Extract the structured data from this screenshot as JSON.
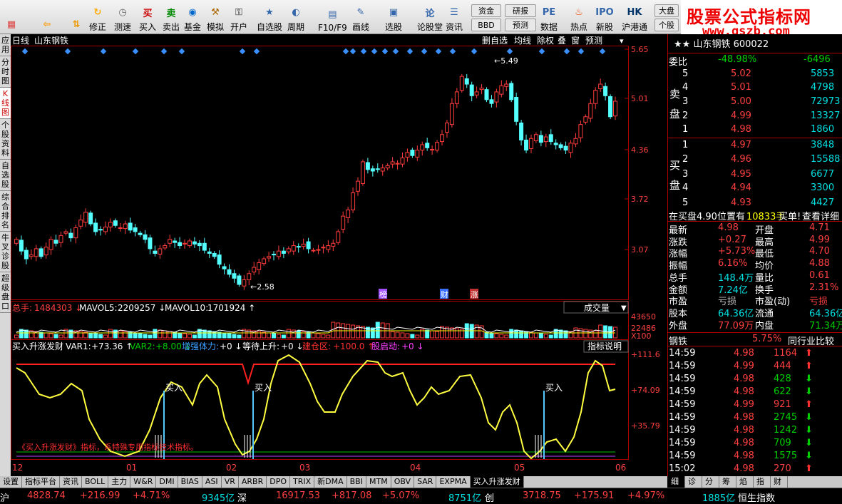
{
  "toolbar": {
    "buttons": [
      {
        "label": "",
        "icon": "grid-icon"
      },
      {
        "label": "",
        "icon": "back-arrow-icon"
      },
      {
        "label": "",
        "icon": "up-down-icon"
      },
      {
        "label": "修正",
        "icon": "restore-icon"
      },
      {
        "label": "测速",
        "icon": "clock-icon"
      },
      {
        "label": "买入",
        "icon": "buy-icon"
      },
      {
        "label": "卖出",
        "icon": "sell-icon"
      },
      {
        "label": "基金",
        "icon": "fund-icon"
      },
      {
        "label": "模拟",
        "icon": "hammer-icon"
      },
      {
        "label": "开户",
        "icon": "lock-icon"
      },
      {
        "label": "自选股",
        "icon": "star-icon"
      },
      {
        "label": "周期",
        "icon": "cycle-icon"
      },
      {
        "label": "F10/F9",
        "icon": "f10-icon"
      },
      {
        "label": "画线",
        "icon": "pen-icon"
      },
      {
        "label": "选股",
        "icon": "select-icon"
      },
      {
        "label": "论股堂",
        "icon": "forum-icon"
      },
      {
        "label": "资讯",
        "icon": "news-icon"
      },
      {
        "label": "数据",
        "icon": "pe-icon"
      },
      {
        "label": "热点",
        "icon": "hot-icon"
      },
      {
        "label": "新股",
        "icon": "ipo-icon"
      },
      {
        "label": "沪港通",
        "icon": "hk-icon"
      }
    ],
    "small_buttons": [
      "资金",
      "BBD",
      "研报",
      "预测",
      "大盘",
      "个股"
    ]
  },
  "logo": {
    "title": "股票公式指标网",
    "url": "www.gszb.com"
  },
  "left_tabs": [
    "应用",
    "分时图",
    "K线图",
    "个股资料",
    "自选股",
    "综合排名",
    "牛叉诊股",
    "超级盘口"
  ],
  "chart": {
    "period_label": "日线",
    "stock_name": "山东钢铁",
    "top_tools": [
      "删自选",
      "均线",
      "除权",
      "叠",
      "窗",
      "预测"
    ],
    "price_axis": [
      "5.65",
      "5.01",
      "4.36",
      "3.72",
      "3.07"
    ],
    "high_label": "5.49",
    "low_label": "2.58",
    "event_labels": [
      "榜",
      "财",
      "涨"
    ],
    "volume": {
      "total_label": "总手:",
      "total": "1484303",
      "ma5_label": "MAVOL5:",
      "ma5": "2209257",
      "ma10_label": "MAVOL10:",
      "ma10": "1701924",
      "dropdown": "成交量",
      "axis": [
        "43650",
        "22486",
        "X100"
      ]
    },
    "indicator": {
      "name": "买入升涨发财",
      "var1_label": "VAR1:",
      "var1": "+73.36",
      "var2_label": "VAR2:",
      "var2": "+8.00",
      "power_label": "增强体力:",
      "power": "+0",
      "wait_label": "等待上升:",
      "wait": "+0",
      "warehouse_label": "建仓区:",
      "warehouse": "+100.0",
      "start_label": "股启动:",
      "start": "+0",
      "help_button": "指标说明",
      "axis": [
        "+111.6",
        "+74.09",
        "+35.79"
      ],
      "buy_label": "买入",
      "watermark": "《买入升涨发财》指标，系特殊专用指标技术指标。"
    },
    "time_axis": [
      "12",
      "01",
      "02",
      "03",
      "04",
      "05",
      "06"
    ]
  },
  "right": {
    "header": "山东钢铁 600022",
    "weibi_label": "委比",
    "weibi": "-48.98%",
    "weicha": "-6496",
    "sell_label": "卖盘",
    "sells": [
      [
        "5",
        "5.02",
        "5853"
      ],
      [
        "4",
        "5.01",
        "4798"
      ],
      [
        "3",
        "5.00",
        "72973"
      ],
      [
        "2",
        "4.99",
        "13327"
      ],
      [
        "1",
        "4.98",
        "1860"
      ]
    ],
    "buy_label": "买盘",
    "buys": [
      [
        "1",
        "4.97",
        "3848"
      ],
      [
        "2",
        "4.96",
        "15588"
      ],
      [
        "3",
        "4.95",
        "6677"
      ],
      [
        "4",
        "4.94",
        "3300"
      ],
      [
        "5",
        "4.93",
        "4427"
      ]
    ],
    "info_line": "在买盘4.90位置有",
    "info_vol": "10833手",
    "info_btn1": "买单!",
    "info_btn2": "查看详细",
    "stats": [
      [
        "最新",
        "4.98",
        "开盘",
        "4.71"
      ],
      [
        "涨跌",
        "+0.27",
        "最高",
        "4.99"
      ],
      [
        "涨幅",
        "+5.73%",
        "最低",
        "4.70"
      ],
      [
        "振幅",
        "6.16%",
        "均价",
        "4.88"
      ],
      [
        "总手",
        "148.4万",
        "量比",
        "0.61"
      ],
      [
        "金额",
        "7.24亿",
        "换手",
        "2.31%"
      ],
      [
        "市盈",
        "亏损",
        "市盈(动)",
        "亏损"
      ],
      [
        "股本",
        "64.36亿",
        "流通",
        "64.36亿"
      ],
      [
        "外盘",
        "77.09万",
        "内盘",
        "71.34万"
      ]
    ],
    "industry": "钢铁",
    "industry_pct": "5.75%",
    "industry_btn": "同行业比较",
    "ticks": [
      [
        "14:59",
        "4.98",
        "1164",
        "up"
      ],
      [
        "14:59",
        "4.99",
        "444",
        "up"
      ],
      [
        "14:59",
        "4.98",
        "428",
        "down"
      ],
      [
        "14:59",
        "4.98",
        "622",
        "down"
      ],
      [
        "14:59",
        "4.99",
        "921",
        "up"
      ],
      [
        "14:59",
        "4.98",
        "2745",
        "down"
      ],
      [
        "14:59",
        "4.98",
        "1242",
        "down"
      ],
      [
        "14:59",
        "4.98",
        "709",
        "down"
      ],
      [
        "14:59",
        "4.98",
        "1575",
        "down"
      ],
      [
        "15:02",
        "4.98",
        "270",
        "up"
      ]
    ],
    "bottom_tabs": [
      "细",
      "诊",
      "分",
      "筹",
      "焰",
      "指",
      "财"
    ]
  },
  "bottom_tabs": [
    "设置",
    "指标平台",
    "资讯",
    "BOLL",
    "主力",
    "W&R",
    "DMI",
    "BIAS",
    "ASI",
    "VR",
    "ARBR",
    "DPO",
    "TRIX",
    "新DMA",
    "BBI",
    "MTM",
    "OBV",
    "SAR",
    "EXPMA",
    "买入升涨发财"
  ],
  "status": [
    {
      "text": "沪",
      "cls": "white"
    },
    {
      "text": "4828.74",
      "cls": "red"
    },
    {
      "text": "+216.99",
      "cls": "red"
    },
    {
      "text": "+4.71%",
      "cls": "red"
    },
    {
      "text": "9345亿",
      "cls": "cyan"
    },
    {
      "text": "深",
      "cls": "white"
    },
    {
      "text": "16917.53",
      "cls": "red"
    },
    {
      "text": "+817.08",
      "cls": "red"
    },
    {
      "text": "+5.07%",
      "cls": "red"
    },
    {
      "text": "8751亿",
      "cls": "cyan"
    },
    {
      "text": "创",
      "cls": "white"
    },
    {
      "text": "3718.75",
      "cls": "red"
    },
    {
      "text": "+175.91",
      "cls": "red"
    },
    {
      "text": "+4.97%",
      "cls": "red"
    },
    {
      "text": "1885亿",
      "cls": "cyan"
    },
    {
      "text": "恒生指数",
      "cls": "white"
    }
  ]
}
